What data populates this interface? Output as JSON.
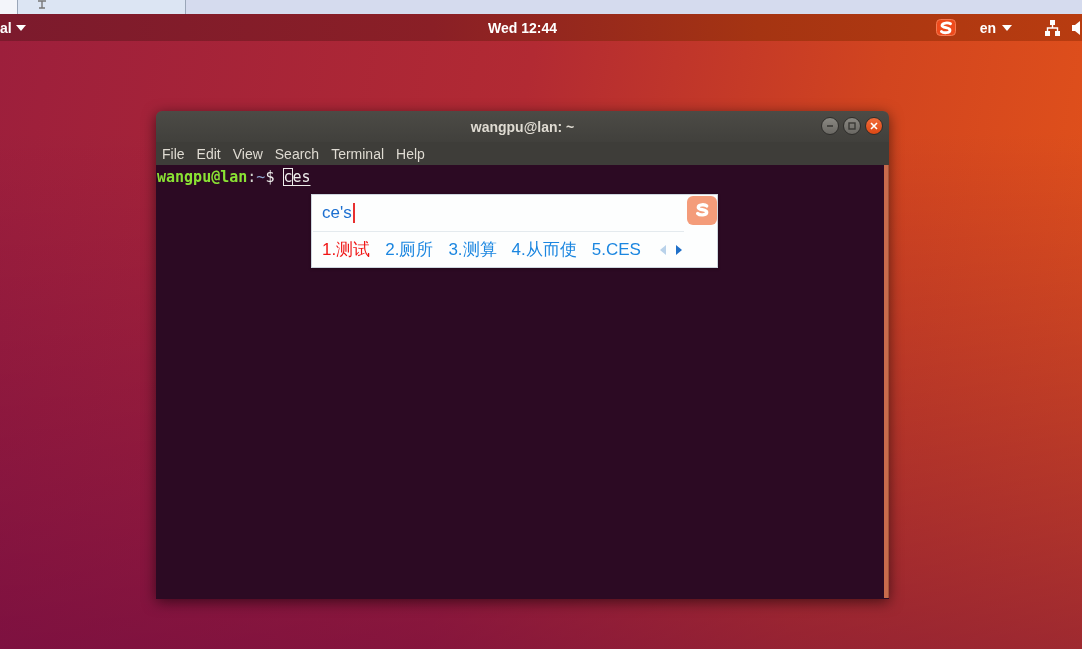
{
  "top_panel": {
    "app_menu": "al",
    "clock": "Wed 12:44",
    "keyboard_layout": "en"
  },
  "terminal": {
    "title": "wangpu@lan: ~",
    "menu": [
      "File",
      "Edit",
      "View",
      "Search",
      "Terminal",
      "Help"
    ],
    "prompt": {
      "user_host": "wangpu@lan",
      "separator": ":",
      "path": "~",
      "symbol": "$"
    },
    "command": "ces"
  },
  "ime": {
    "composition": "ce's",
    "candidates": [
      {
        "label": "1.测试",
        "selected": true
      },
      {
        "label": "2.厕所",
        "selected": false
      },
      {
        "label": "3.测算",
        "selected": false
      },
      {
        "label": "4.从而使",
        "selected": false
      },
      {
        "label": "5.CES",
        "selected": false
      }
    ],
    "page_arrows": [
      {
        "kind": "prev",
        "disabled": true
      },
      {
        "kind": "next",
        "disabled": false
      }
    ]
  }
}
